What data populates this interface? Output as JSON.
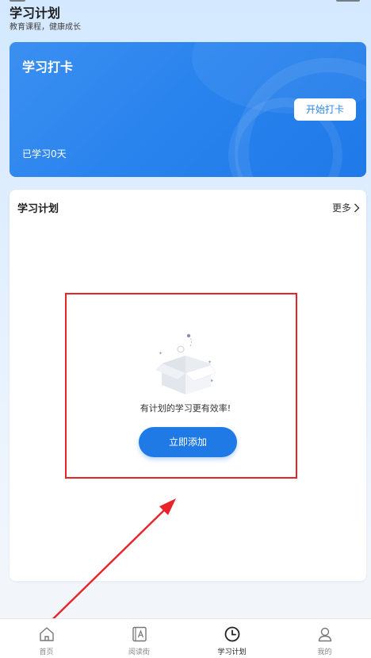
{
  "header": {
    "title": "学习计划",
    "subtitle": "教育课程，健康成长"
  },
  "checkin": {
    "title": "学习打卡",
    "button_label": "开始打卡",
    "days_text": "已学习0天"
  },
  "plan": {
    "title": "学习计划",
    "more_label": "更多",
    "empty_text": "有计划的学习更有效率!",
    "add_button_label": "立即添加"
  },
  "tabbar": {
    "items": [
      {
        "label": "首页",
        "icon": "home-icon",
        "active": false
      },
      {
        "label": "阅读街",
        "icon": "book-icon",
        "active": false
      },
      {
        "label": "学习计划",
        "icon": "clock-icon",
        "active": true
      },
      {
        "label": "我的",
        "icon": "user-icon",
        "active": false
      }
    ]
  },
  "colors": {
    "accent": "#1f7ae6",
    "card_blue": "#2a84ee",
    "highlight_red": "#e8232a"
  }
}
